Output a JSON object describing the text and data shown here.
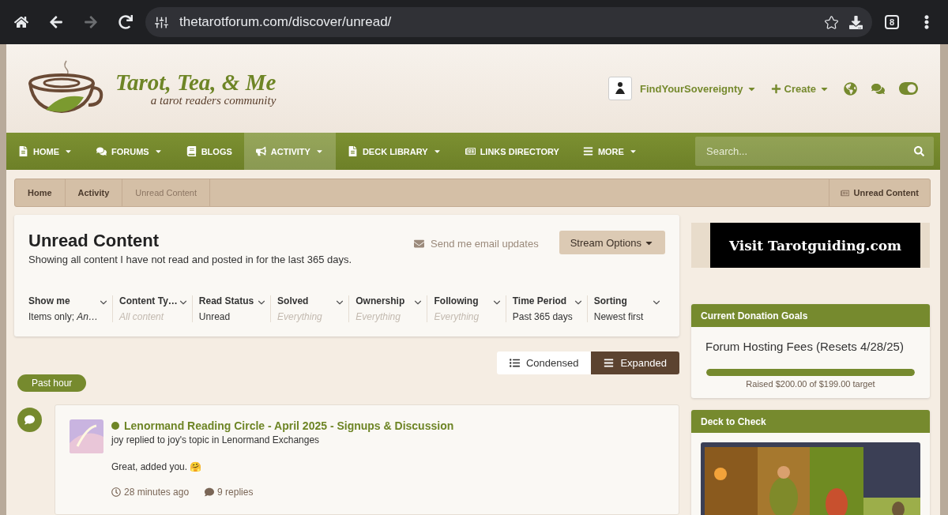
{
  "browser": {
    "url": "thetarotforum.com/discover/unread/",
    "tab_count": "8"
  },
  "header": {
    "logo_title": "Tarot, Tea, & Me",
    "logo_tagline": "a tarot readers community",
    "user": "FindYourSovereignty",
    "create": "Create"
  },
  "nav": {
    "items": [
      {
        "kind": "page",
        "label": "HOME",
        "dropdown": true,
        "selected": false
      },
      {
        "kind": "chat",
        "label": "FORUMS",
        "dropdown": true,
        "selected": false
      },
      {
        "kind": "book",
        "label": "BLOGS",
        "dropdown": false,
        "selected": false
      },
      {
        "kind": "megaphone",
        "label": "ACTIVITY",
        "dropdown": true,
        "selected": true
      },
      {
        "kind": "page",
        "label": "DECK LIBRARY",
        "dropdown": true,
        "selected": false
      },
      {
        "kind": "doc",
        "label": "LINKS DIRECTORY",
        "dropdown": false,
        "selected": false
      },
      {
        "kind": "menu",
        "label": "MORE",
        "dropdown": true,
        "selected": false
      }
    ],
    "search": {
      "placeholder": "Search..."
    }
  },
  "breadcrumb": {
    "items": [
      {
        "label": "Home",
        "current": false
      },
      {
        "label": "Activity",
        "current": false
      },
      {
        "label": "Unread Content",
        "current": true
      }
    ],
    "right": "Unread Content"
  },
  "stream": {
    "title": "Unread Content",
    "description": "Showing all content I have not read and posted in for the last 365 days.",
    "email_link": "Send me email updates",
    "options_button": "Stream Options",
    "filters": [
      {
        "label": "Show me",
        "value": "Items only; *An…*",
        "placeholder": false
      },
      {
        "label": "Content Ty…",
        "value": "All content",
        "placeholder": true
      },
      {
        "label": "Read Status",
        "value": "Unread",
        "placeholder": false
      },
      {
        "label": "Solved",
        "value": "Everything",
        "placeholder": true
      },
      {
        "label": "Ownership",
        "value": "Everything",
        "placeholder": true
      },
      {
        "label": "Following",
        "value": "Everything",
        "placeholder": true
      },
      {
        "label": "Time Period",
        "value": "Past 365 days",
        "placeholder": false
      },
      {
        "label": "Sorting",
        "value": "Newest first",
        "placeholder": false
      }
    ],
    "view_modes": [
      {
        "kind": "list",
        "label": "Condensed",
        "selected": false
      },
      {
        "kind": "lines",
        "label": "Expanded",
        "selected": true
      }
    ],
    "group_label": "Past hour",
    "posts": [
      {
        "unread": true,
        "title": "Lenormand Reading Circle - April 2025 - Signups & Discussion",
        "meta": "joy replied to joy's topic in Lenormand Exchanges",
        "snippet": "Great, added you. 🤗",
        "time": "28 minutes ago",
        "replies": "9 replies"
      }
    ]
  },
  "sidebar": {
    "ad": "Visit Tarotguiding.com",
    "donation": {
      "title": "Current Donation Goals",
      "goal": "Forum Hosting Fees (Resets 4/28/25)",
      "level": 1,
      "caption": "Raised $200.00 of $199.00 target"
    },
    "deck": {
      "title": "Deck to Check"
    }
  }
}
